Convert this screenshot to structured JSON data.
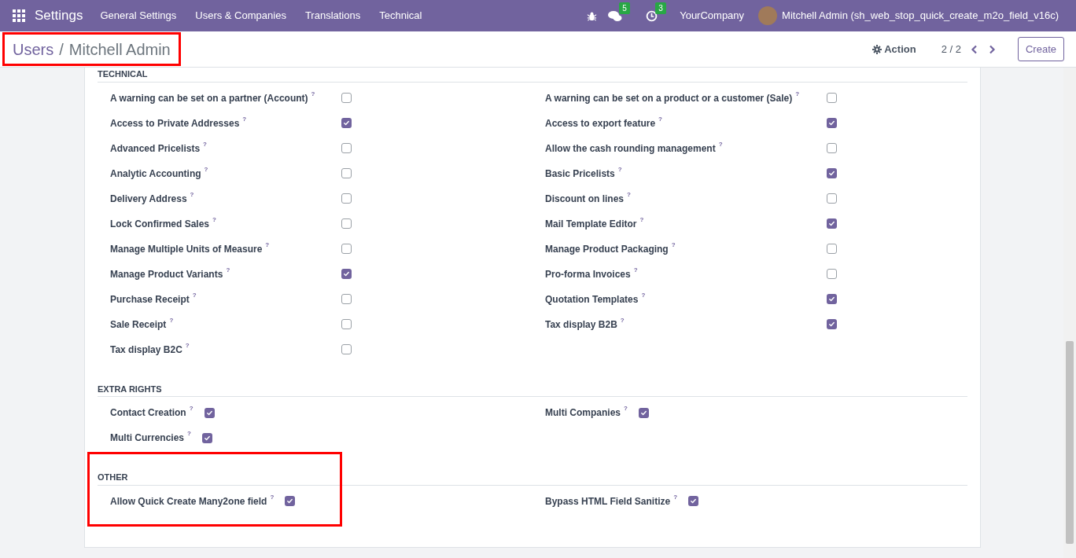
{
  "navbar": {
    "app": "Settings",
    "menu": [
      "General Settings",
      "Users & Companies",
      "Translations",
      "Technical"
    ],
    "messages_count": "5",
    "activities_count": "3",
    "company": "YourCompany",
    "user": "Mitchell Admin (sh_web_stop_quick_create_m2o_field_v16c)"
  },
  "control_panel": {
    "breadcrumb": [
      {
        "label": "Users"
      },
      {
        "label": "Mitchell Admin"
      }
    ],
    "breadcrumb_separator": "/",
    "breadcrumb_highlighted": true,
    "action": "Action",
    "pager": "2 / 2",
    "create": "Create"
  },
  "sections": [
    {
      "title": "TECHNICAL",
      "kind": "aligned",
      "highlighted": false,
      "rows": [
        [
          {
            "label": "A warning can be set on a partner (Account)",
            "tooltip": "?",
            "checked": false
          },
          {
            "label": "A warning can be set on a product or a customer (Sale)",
            "tooltip": "?",
            "checked": false
          }
        ],
        [
          {
            "label": "Access to Private Addresses",
            "tooltip": "?",
            "checked": true
          },
          {
            "label": "Access to export feature",
            "tooltip": "?",
            "checked": true
          }
        ],
        [
          {
            "label": "Advanced Pricelists",
            "tooltip": "?",
            "checked": false
          },
          {
            "label": "Allow the cash rounding management",
            "tooltip": "?",
            "checked": false
          }
        ],
        [
          {
            "label": "Analytic Accounting",
            "tooltip": "?",
            "checked": false
          },
          {
            "label": "Basic Pricelists",
            "tooltip": "?",
            "checked": true
          }
        ],
        [
          {
            "label": "Delivery Address",
            "tooltip": "?",
            "checked": false
          },
          {
            "label": "Discount on lines",
            "tooltip": "?",
            "checked": false
          }
        ],
        [
          {
            "label": "Lock Confirmed Sales",
            "tooltip": "?",
            "checked": false
          },
          {
            "label": "Mail Template Editor",
            "tooltip": "?",
            "checked": true
          }
        ],
        [
          {
            "label": "Manage Multiple Units of Measure",
            "tooltip": "?",
            "checked": false
          },
          {
            "label": "Manage Product Packaging",
            "tooltip": "?",
            "checked": false
          }
        ],
        [
          {
            "label": "Manage Product Variants",
            "tooltip": "?",
            "checked": true
          },
          {
            "label": "Pro-forma Invoices",
            "tooltip": "?",
            "checked": false
          }
        ],
        [
          {
            "label": "Purchase Receipt",
            "tooltip": "?",
            "checked": false
          },
          {
            "label": "Quotation Templates",
            "tooltip": "?",
            "checked": true
          }
        ],
        [
          {
            "label": "Sale Receipt",
            "tooltip": "?",
            "checked": false
          },
          {
            "label": "Tax display B2B",
            "tooltip": "?",
            "checked": true
          }
        ],
        [
          {
            "label": "Tax display B2C",
            "tooltip": "?",
            "checked": false
          }
        ]
      ]
    },
    {
      "title": "EXTRA RIGHTS",
      "kind": "inline",
      "highlighted": false,
      "rows": [
        [
          {
            "label": "Contact Creation",
            "tooltip": "?",
            "checked": true
          },
          {
            "label": "Multi Companies",
            "tooltip": "?",
            "checked": true
          }
        ],
        [
          {
            "label": "Multi Currencies",
            "tooltip": "?",
            "checked": true
          }
        ]
      ]
    },
    {
      "title": "OTHER",
      "kind": "inline",
      "highlighted": true,
      "rows": [
        [
          {
            "label": "Allow Quick Create Many2one field",
            "tooltip": "?",
            "checked": true
          },
          {
            "label": "Bypass HTML Field Sanitize",
            "tooltip": "?",
            "checked": true
          }
        ]
      ]
    }
  ]
}
